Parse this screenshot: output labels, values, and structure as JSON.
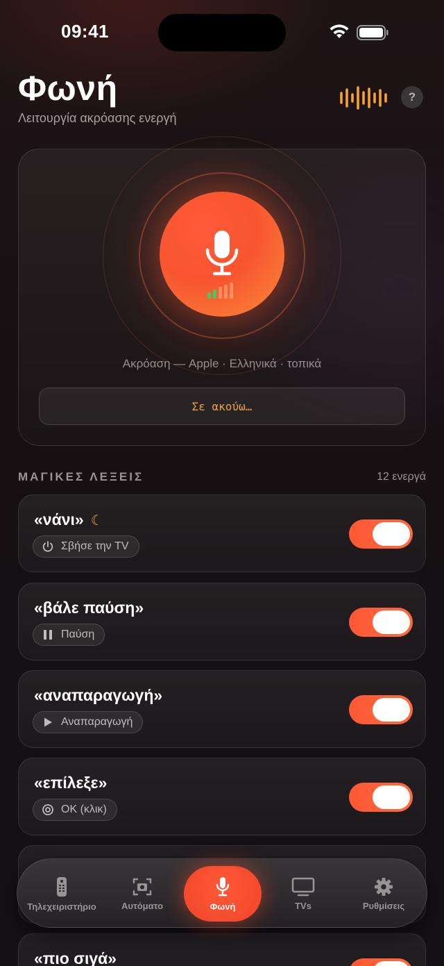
{
  "status": {
    "time": "09:41"
  },
  "header": {
    "title": "Φωνή",
    "subtitle": "Λειτουργία ακρόασης ενεργή",
    "help": "?"
  },
  "listening": {
    "engine_line": "Ακρόαση — Apple · Ελληνικά · τοπικά",
    "transcript": "Σε ακούω…"
  },
  "section": {
    "title": "ΜΑΓΙΚΕΣ ΛΕΞΕΙΣ",
    "count": "12 ενεργά"
  },
  "words": [
    {
      "phrase": "«νάνι»",
      "action": "Σβήσε την TV",
      "action_icon": "power-icon",
      "enabled": true,
      "badge": "moon-icon"
    },
    {
      "phrase": "«βάλε παύση»",
      "action": "Παύση",
      "action_icon": "pause-icon",
      "enabled": true
    },
    {
      "phrase": "«αναπαραγωγή»",
      "action": "Αναπαραγωγή",
      "action_icon": "play-icon",
      "enabled": true
    },
    {
      "phrase": "«επίλεξε»",
      "action": "OK (κλικ)",
      "action_icon": "target-icon",
      "enabled": true
    },
    {
      "phrase": "«πιο σιγά»",
      "enabled": true
    }
  ],
  "tabs": [
    {
      "label": "Τηλεχειριστήριο",
      "icon": "remote-icon"
    },
    {
      "label": "Αυτόματο",
      "icon": "camera-scan-icon"
    },
    {
      "label": "Φωνή",
      "icon": "mic-icon",
      "active": true
    },
    {
      "label": "TVs",
      "icon": "tv-icon"
    },
    {
      "label": "Ρυθμίσεις",
      "icon": "gear-icon"
    }
  ],
  "colors": {
    "accent": "#ff5a36",
    "accent_orange": "#f5a038",
    "background": "#161012"
  }
}
